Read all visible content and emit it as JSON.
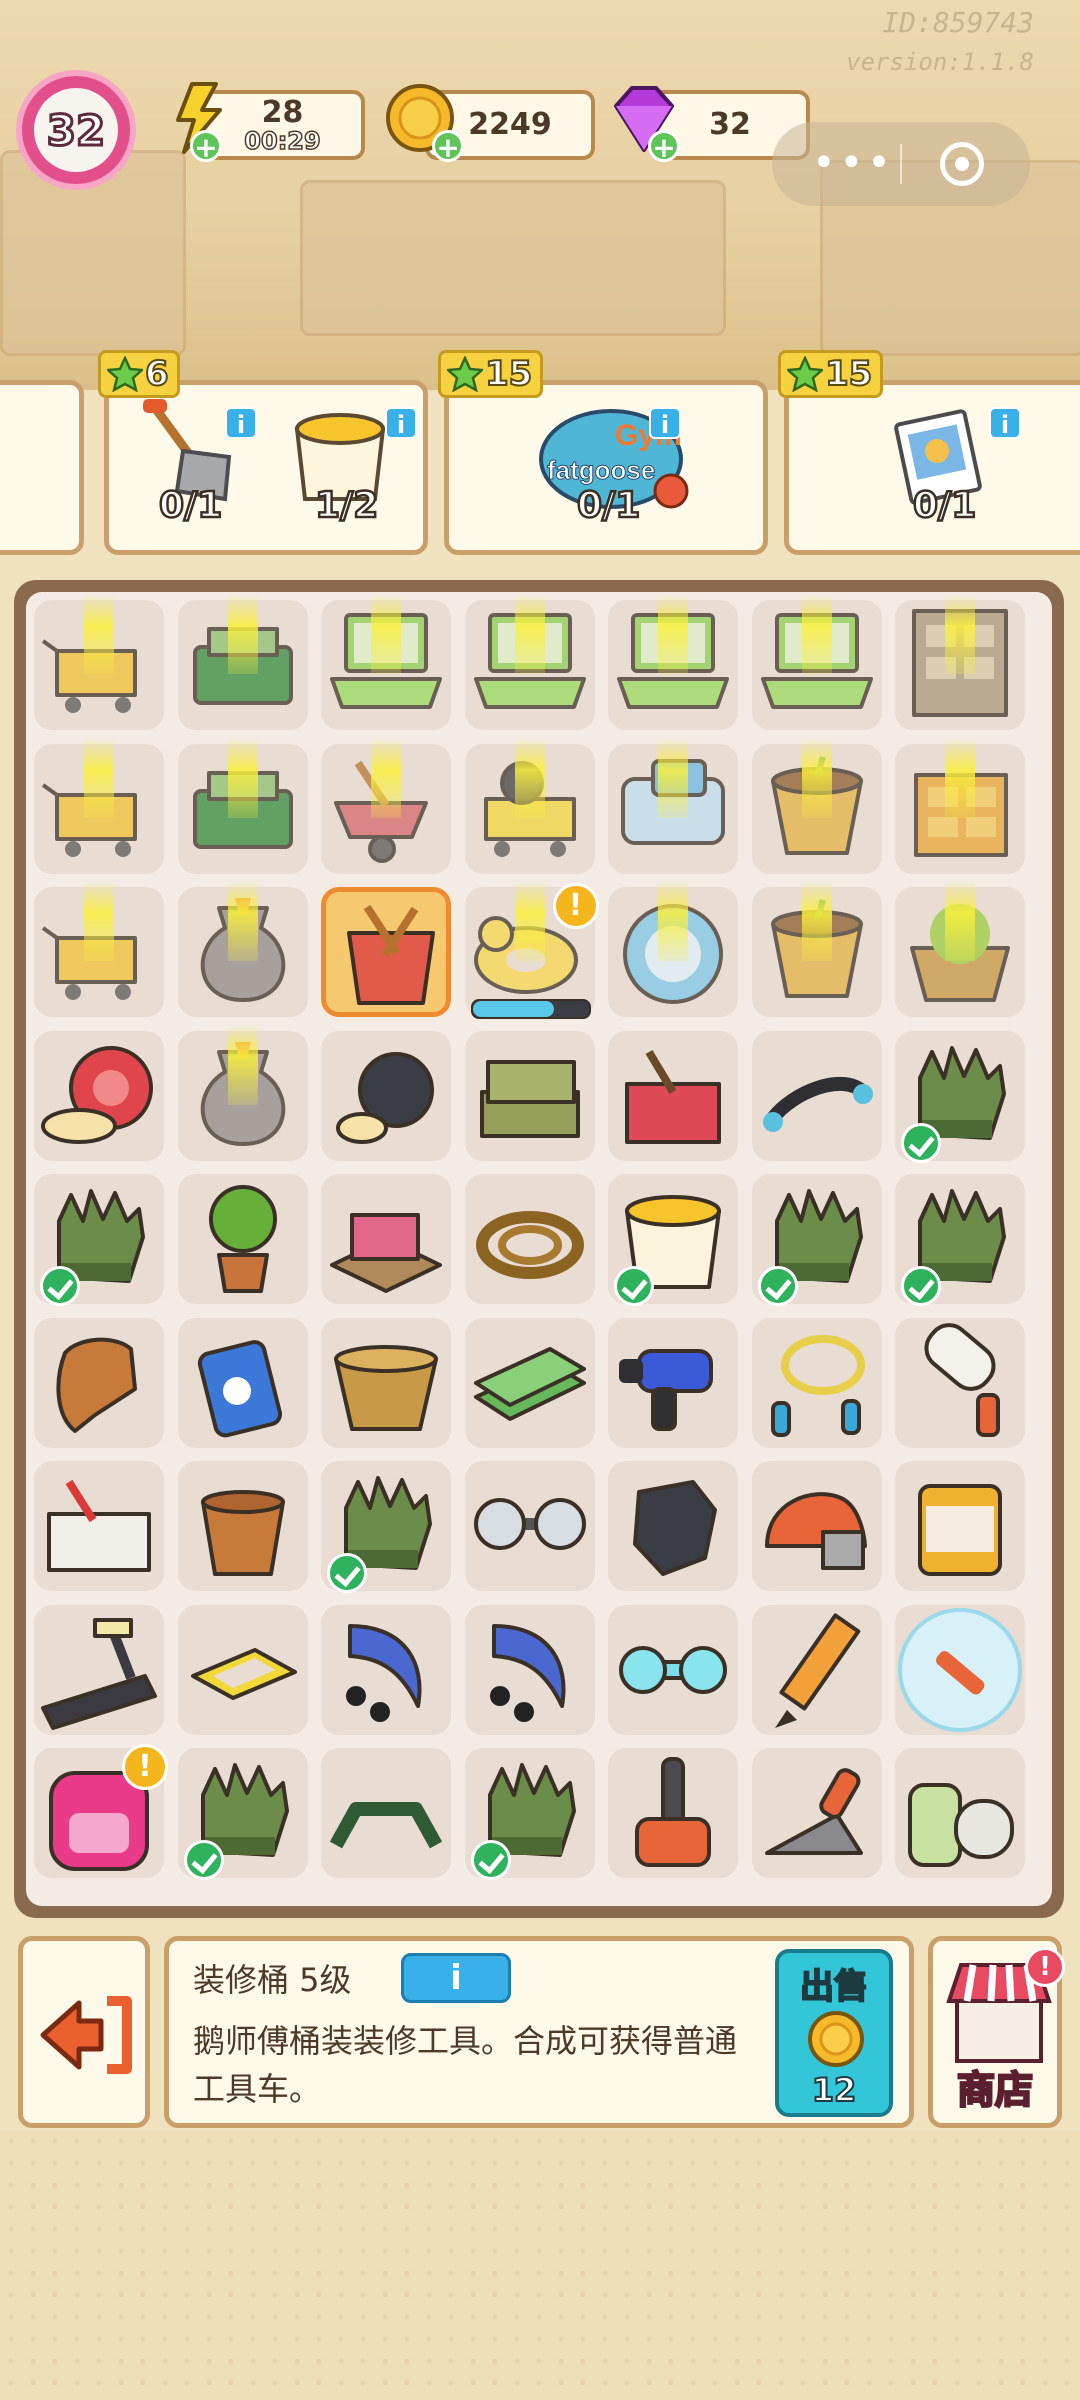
{
  "header": {
    "user_id": "ID:859743",
    "version": "version:1.1.8",
    "level": "32",
    "energy": {
      "value": "28",
      "timer": "00:29",
      "icon": "lightning-icon"
    },
    "coins": {
      "value": "2249",
      "icon": "coin-icon"
    },
    "gems": {
      "value": "32",
      "icon": "gem-icon"
    }
  },
  "miniprogram": {
    "more": "•••",
    "close_icon": "target-icon"
  },
  "orders": [
    {
      "reward": "6",
      "items": [
        {
          "name": "shovel",
          "count": "0/1"
        },
        {
          "name": "paint bucket",
          "count": "1/2"
        }
      ]
    },
    {
      "reward": "15",
      "items": [
        {
          "name": "fat goose gym sign",
          "count": "0/1"
        }
      ]
    },
    {
      "reward": "15",
      "items": [
        {
          "name": "photo frame",
          "count": "0/1"
        }
      ]
    }
  ],
  "selected_item": {
    "name": "装修桶 5级",
    "info_label": "i",
    "description": "鹅师傅桶装装修工具。合成可获得普通工具车。",
    "sell_label": "出售",
    "sell_price": "12"
  },
  "shop": {
    "label": "商店"
  },
  "colors": {
    "accent": "#3ab0e8",
    "level": "#e34f8a",
    "check": "#2fb25d",
    "board": "#8a6a4e"
  }
}
